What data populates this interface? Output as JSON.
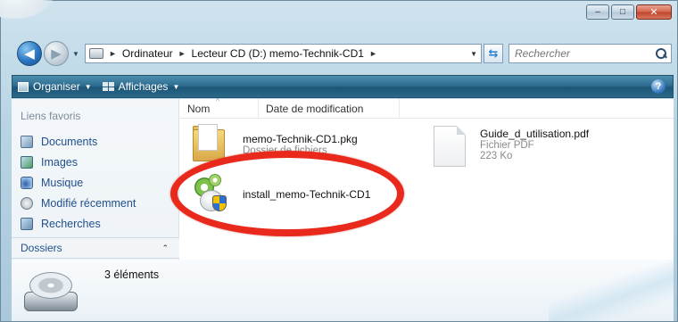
{
  "window": {
    "caption_buttons": {
      "minimize": "–",
      "maximize": "□",
      "close": "✕"
    }
  },
  "address_bar": {
    "crumbs": [
      "Ordinateur",
      "Lecteur CD (D:) memo-Technik-CD1"
    ],
    "separator": "►",
    "search_placeholder": "Rechercher"
  },
  "command_bar": {
    "organise": "Organiser",
    "views": "Affichages",
    "help": "?"
  },
  "nav_pane": {
    "favorites_title": "Liens favoris",
    "favorites": [
      {
        "label": "Documents",
        "icon": "documents-icon"
      },
      {
        "label": "Images",
        "icon": "pictures-icon"
      },
      {
        "label": "Musique",
        "icon": "music-icon"
      },
      {
        "label": "Modifié récemment",
        "icon": "recent-icon"
      },
      {
        "label": "Recherches",
        "icon": "searches-icon"
      }
    ],
    "folders_label": "Dossiers",
    "folders_chevron": "⌃"
  },
  "columns": {
    "name": "Nom",
    "date": "Date de modification"
  },
  "items": [
    {
      "name": "memo-Technik-CD1.pkg",
      "type": "Dossier de fichiers",
      "icon": "folder-icon"
    },
    {
      "name": "Guide_d_utilisation.pdf",
      "type": "Fichier PDF",
      "size": "223 Ko",
      "icon": "pdf-icon"
    },
    {
      "name": "install_memo-Technik-CD1",
      "icon": "installer-icon"
    }
  ],
  "status": {
    "count": "3 éléments"
  },
  "colors": {
    "highlight_ring": "#e8291b",
    "command_bar": "#2f6d90",
    "link": "#1f4f8c"
  }
}
